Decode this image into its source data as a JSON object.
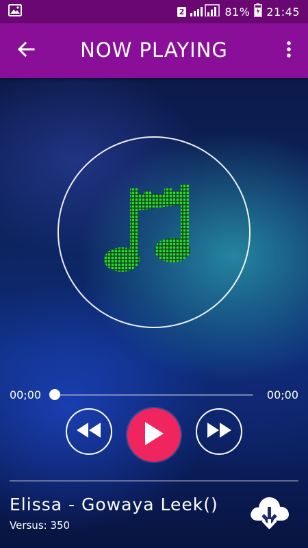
{
  "status_bar": {
    "sim_number": "2",
    "battery": "81%",
    "time": "21:45",
    "icons": [
      "image-icon",
      "signal-icon",
      "battery-icon"
    ]
  },
  "toolbar": {
    "title": "NOW PLAYING",
    "back_icon": "back-arrow-icon",
    "menu_icon": "more-vert-icon"
  },
  "player": {
    "elapsed": "00;00",
    "duration": "00;00",
    "progress": 0,
    "album_icon": "music-note-icon",
    "controls": [
      "rewind-icon",
      "play-icon",
      "fast-forward-icon"
    ]
  },
  "track": {
    "title": "Elissa - Gowaya Leek()",
    "subtitle": "Versus: 350",
    "download_icon": "cloud-download-icon"
  },
  "colors": {
    "status_bar": "#6a0772",
    "toolbar": "#8a0f98",
    "play_button": "#f0245e",
    "note": "#2bd63a"
  }
}
